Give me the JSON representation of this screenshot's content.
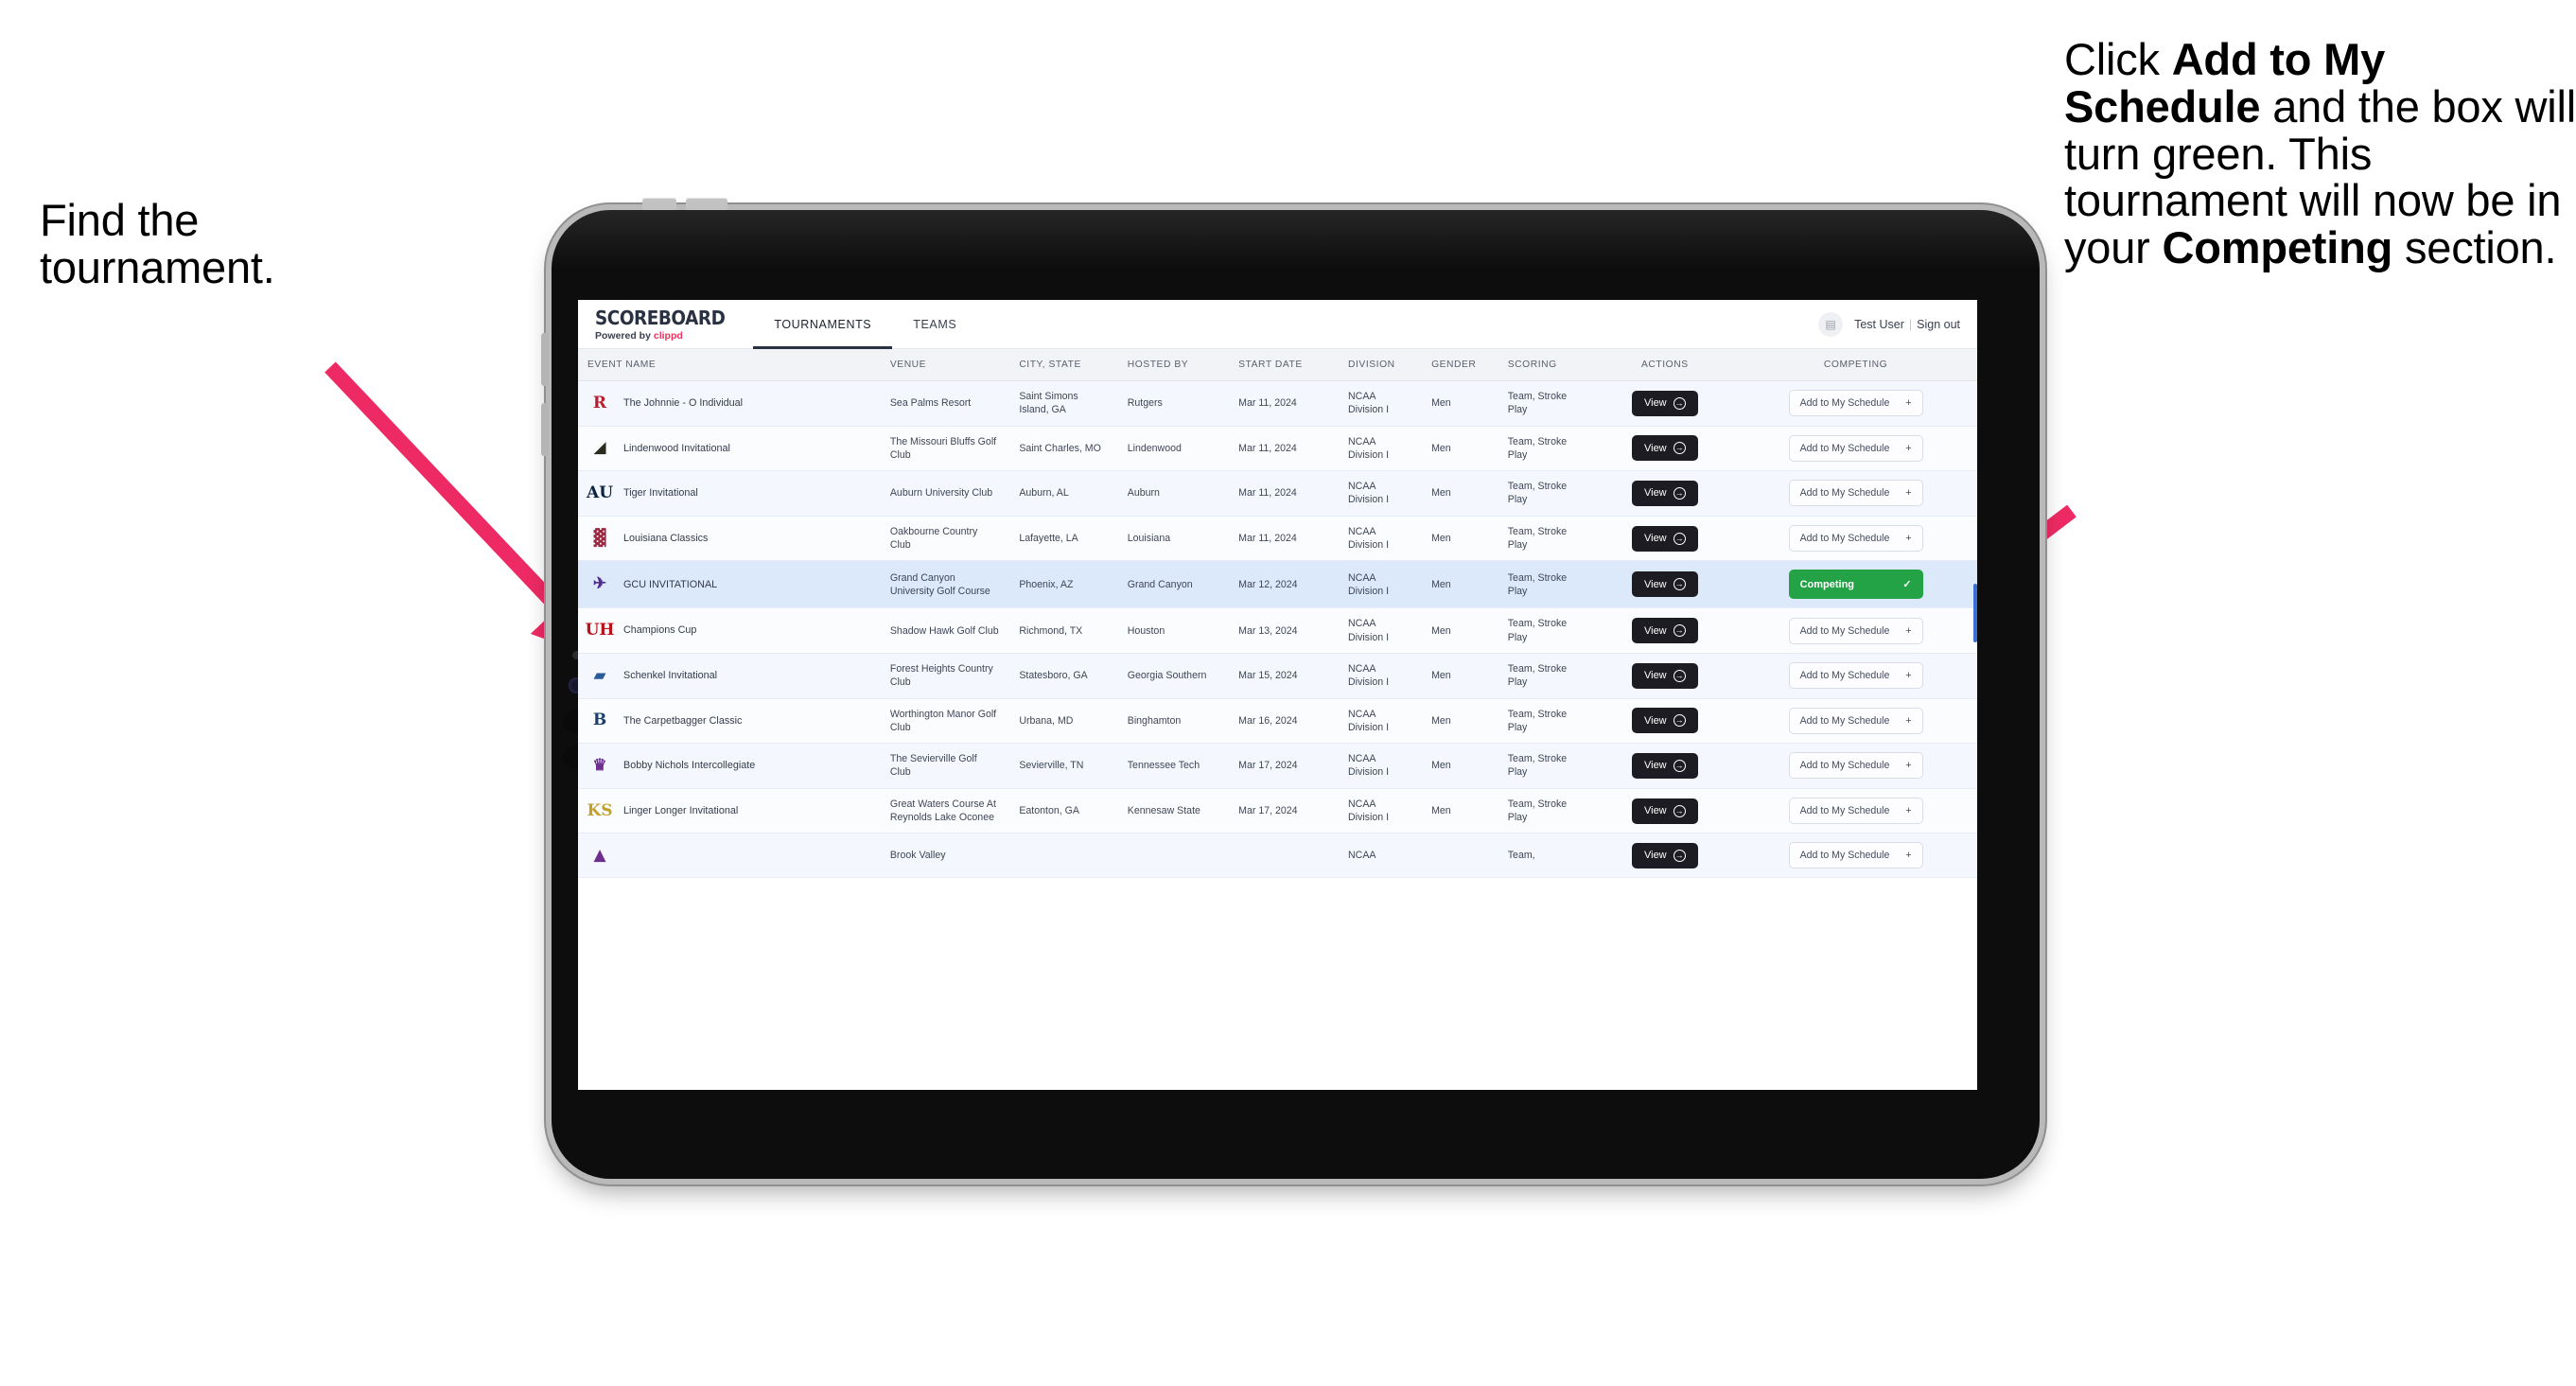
{
  "annotations": {
    "left": {
      "line1": "Find the",
      "line2": "tournament."
    },
    "right": {
      "p1_a": "Click ",
      "p1_b": "Add to My Schedule",
      "p1_c": " and the box will turn green. ",
      "p2_a": "This tournament will now be in your ",
      "p2_b": "Competing",
      "p2_c": " section."
    },
    "arrow_color": "#ee2a64"
  },
  "app": {
    "logo": {
      "main": "SCOREBOARD",
      "sub_prefix": "Powered by ",
      "sub_brand": "clippd"
    },
    "tabs": [
      {
        "label": "TOURNAMENTS",
        "active": true
      },
      {
        "label": "TEAMS",
        "active": false
      }
    ],
    "user": {
      "avatar_icon": "user-grid-icon",
      "name": "Test User",
      "separator": "|",
      "signout": "Sign out"
    }
  },
  "table": {
    "columns": [
      "EVENT NAME",
      "VENUE",
      "CITY, STATE",
      "HOSTED BY",
      "START DATE",
      "DIVISION",
      "GENDER",
      "SCORING",
      "ACTIONS",
      "COMPETING"
    ],
    "action_label": "View",
    "add_label": "Add to My Schedule",
    "add_icon": "plus-icon",
    "competing_label": "Competing",
    "competing_icon": "check-icon",
    "competing_color": "#23a345",
    "rows": [
      {
        "logo": "R",
        "logo_color": "#b81d2e",
        "event": "The Johnnie - O Individual",
        "venue": "Sea Palms Resort",
        "city": "Saint Simons Island, GA",
        "host": "Rutgers",
        "date": "Mar 11, 2024",
        "division": "NCAA Division I",
        "gender": "Men",
        "scoring": "Team, Stroke Play",
        "competing": false
      },
      {
        "logo": "◢",
        "logo_color": "#2b2b20",
        "event": "Lindenwood Invitational",
        "venue": "The Missouri Bluffs Golf Club",
        "city": "Saint Charles, MO",
        "host": "Lindenwood",
        "date": "Mar 11, 2024",
        "division": "NCAA Division I",
        "gender": "Men",
        "scoring": "Team, Stroke Play",
        "competing": false
      },
      {
        "logo": "AU",
        "logo_color": "#0c2340",
        "event": "Tiger Invitational",
        "venue": "Auburn University Club",
        "city": "Auburn, AL",
        "host": "Auburn",
        "date": "Mar 11, 2024",
        "division": "NCAA Division I",
        "gender": "Men",
        "scoring": "Team, Stroke Play",
        "competing": false
      },
      {
        "logo": "▓",
        "logo_color": "#9b2743",
        "event": "Louisiana Classics",
        "venue": "Oakbourne Country Club",
        "city": "Lafayette, LA",
        "host": "Louisiana",
        "date": "Mar 11, 2024",
        "division": "NCAA Division I",
        "gender": "Men",
        "scoring": "Team, Stroke Play",
        "competing": false
      },
      {
        "logo": "✈",
        "logo_color": "#4f2d8f",
        "event": "GCU INVITATIONAL",
        "venue": "Grand Canyon University Golf Course",
        "city": "Phoenix, AZ",
        "host": "Grand Canyon",
        "date": "Mar 12, 2024",
        "division": "NCAA Division I",
        "gender": "Men",
        "scoring": "Team, Stroke Play",
        "competing": true
      },
      {
        "logo": "UH",
        "logo_color": "#b8121b",
        "event": "Champions Cup",
        "venue": "Shadow Hawk Golf Club",
        "city": "Richmond, TX",
        "host": "Houston",
        "date": "Mar 13, 2024",
        "division": "NCAA Division I",
        "gender": "Men",
        "scoring": "Team, Stroke Play",
        "competing": false
      },
      {
        "logo": "▰",
        "logo_color": "#2b5a9b",
        "event": "Schenkel Invitational",
        "venue": "Forest Heights Country Club",
        "city": "Statesboro, GA",
        "host": "Georgia Southern",
        "date": "Mar 15, 2024",
        "division": "NCAA Division I",
        "gender": "Men",
        "scoring": "Team, Stroke Play",
        "competing": false
      },
      {
        "logo": "B",
        "logo_color": "#1c3f6e",
        "event": "The Carpetbagger Classic",
        "venue": "Worthington Manor Golf Club",
        "city": "Urbana, MD",
        "host": "Binghamton",
        "date": "Mar 16, 2024",
        "division": "NCAA Division I",
        "gender": "Men",
        "scoring": "Team, Stroke Play",
        "competing": false
      },
      {
        "logo": "♛",
        "logo_color": "#6d2f8f",
        "event": "Bobby Nichols Intercollegiate",
        "venue": "The Sevierville Golf Club",
        "city": "Sevierville, TN",
        "host": "Tennessee Tech",
        "date": "Mar 17, 2024",
        "division": "NCAA Division I",
        "gender": "Men",
        "scoring": "Team, Stroke Play",
        "competing": false
      },
      {
        "logo": "KS",
        "logo_color": "#c2a12b",
        "event": "Linger Longer Invitational",
        "venue": "Great Waters Course At Reynolds Lake Oconee",
        "city": "Eatonton, GA",
        "host": "Kennesaw State",
        "date": "Mar 17, 2024",
        "division": "NCAA Division I",
        "gender": "Men",
        "scoring": "Team, Stroke Play",
        "competing": false
      },
      {
        "logo": "▲",
        "logo_color": "#6d2f8f",
        "event": "",
        "venue": "Brook Valley",
        "city": "",
        "host": "",
        "date": "",
        "division": "NCAA",
        "gender": "",
        "scoring": "Team,",
        "competing": false
      }
    ]
  }
}
